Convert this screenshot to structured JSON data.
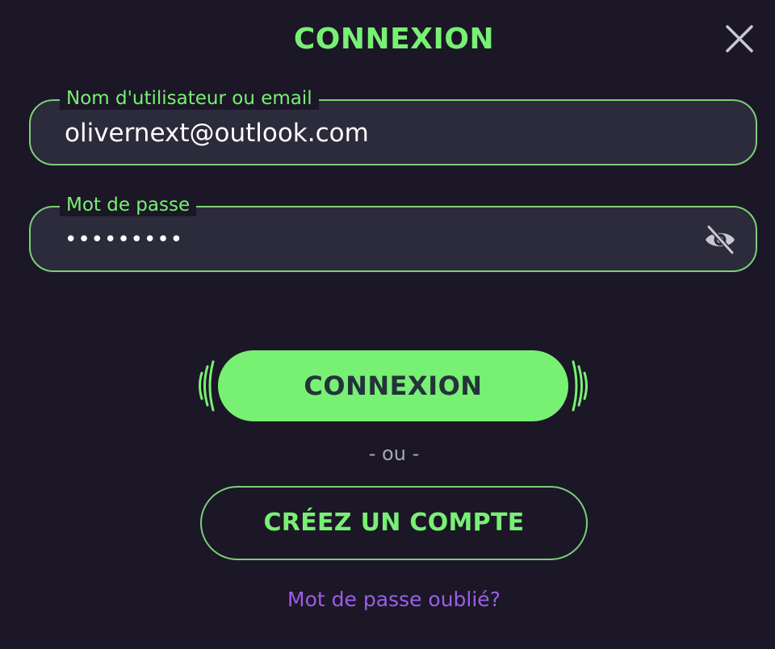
{
  "modal": {
    "title": "CONNEXION"
  },
  "email_field": {
    "label": "Nom d'utilisateur ou email",
    "value": "olivernext@outlook.com"
  },
  "password_field": {
    "label": "Mot de passe",
    "value": "•••••••••",
    "toggle_icon": "eye-off-icon"
  },
  "actions": {
    "login_label": "CONNEXION",
    "or_separator": "- ou -",
    "create_account_label": "CRÉEZ UN COMPTE",
    "forgot_password_label": "Mot de passe oublié?"
  },
  "colors": {
    "background": "#1b1726",
    "accent_green": "#78f074",
    "field_background": "#2b2b3b",
    "link_purple": "#9b5ee8"
  }
}
